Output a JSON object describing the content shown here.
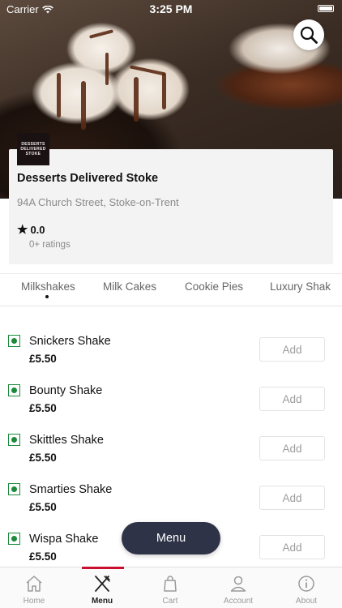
{
  "status_bar": {
    "carrier": "Carrier",
    "time": "3:25 PM"
  },
  "store": {
    "logo_text_line1": "DESSERTS",
    "logo_text_line2": "DELIVERED STOKE",
    "name": "Desserts Delivered Stoke",
    "address": "94A Church Street, Stoke-on-Trent",
    "rating": "0.0",
    "rating_count": "0+ ratings"
  },
  "tabs": [
    {
      "label": "Milkshakes",
      "active": true
    },
    {
      "label": "Milk Cakes"
    },
    {
      "label": "Cookie Pies"
    },
    {
      "label": "Luxury Shak"
    }
  ],
  "items": [
    {
      "name": "Snickers Shake",
      "price": "£5.50",
      "add_label": "Add"
    },
    {
      "name": "Bounty Shake",
      "price": "£5.50",
      "add_label": "Add"
    },
    {
      "name": "Skittles Shake",
      "price": "£5.50",
      "add_label": "Add"
    },
    {
      "name": "Smarties Shake",
      "price": "£5.50",
      "add_label": "Add"
    },
    {
      "name": "Wispa Shake",
      "price": "£5.50",
      "add_label": "Add"
    }
  ],
  "float_menu_label": "Menu",
  "bottom_nav": [
    {
      "label": "Home",
      "icon": "home-icon"
    },
    {
      "label": "Menu",
      "icon": "cutlery-icon",
      "active": true
    },
    {
      "label": "Cart",
      "icon": "bag-icon"
    },
    {
      "label": "Account",
      "icon": "user-icon"
    },
    {
      "label": "About",
      "icon": "info-icon"
    }
  ],
  "colors": {
    "accent": "#c8102e",
    "veg": "#1c8a3a",
    "float_menu": "#2f3347"
  }
}
